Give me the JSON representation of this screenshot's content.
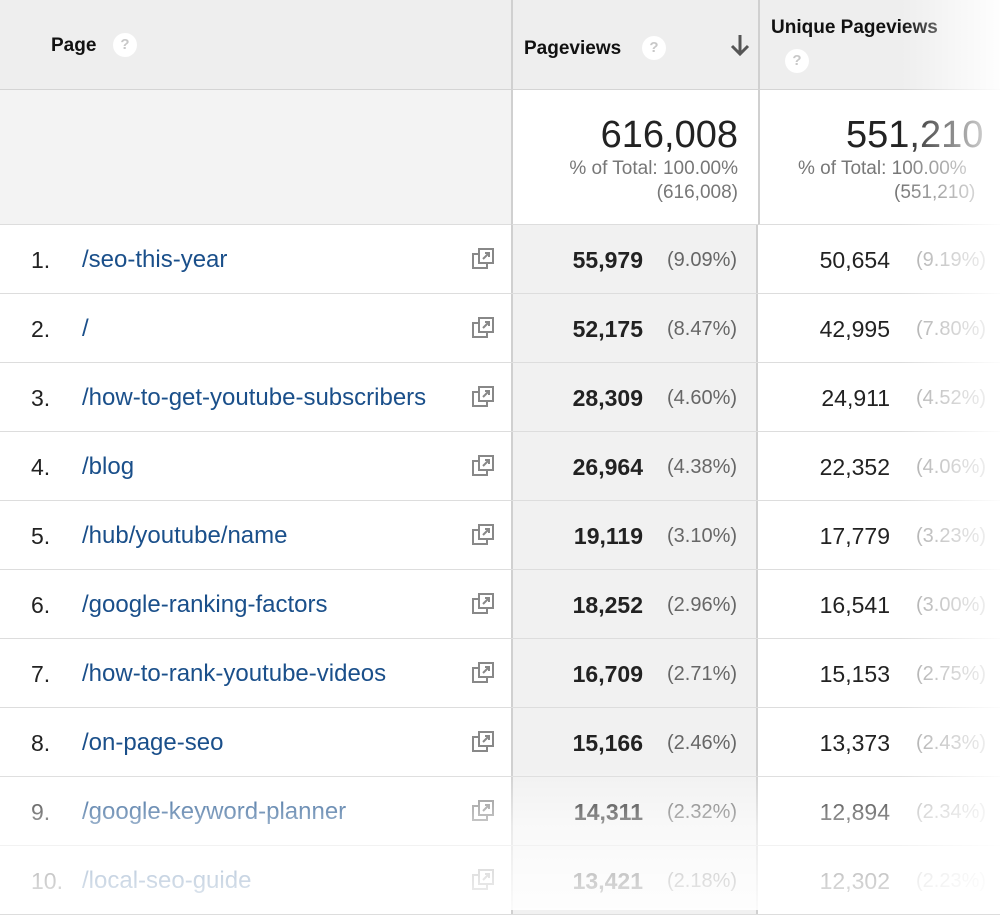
{
  "header": {
    "page_label": "Page",
    "pageviews_label": "Pageviews",
    "unique_pageviews_label": "Unique Pageviews",
    "help_glyph": "?"
  },
  "totals": {
    "pageviews": {
      "value": "616,008",
      "pct_text": "% of Total: 100.00%",
      "paren": "(616,008)"
    },
    "unique_pageviews": {
      "value": "551,210",
      "pct_text": "% of Total: 100.00%",
      "paren": "(551,210)"
    }
  },
  "rows": [
    {
      "idx": "1.",
      "page": "/seo-this-year",
      "pv": "55,979",
      "pv_pct": "(9.09%)",
      "upv": "50,654",
      "upv_pct": "(9.19%)"
    },
    {
      "idx": "2.",
      "page": "/",
      "pv": "52,175",
      "pv_pct": "(8.47%)",
      "upv": "42,995",
      "upv_pct": "(7.80%)"
    },
    {
      "idx": "3.",
      "page": "/how-to-get-youtube-subscribers",
      "pv": "28,309",
      "pv_pct": "(4.60%)",
      "upv": "24,911",
      "upv_pct": "(4.52%)"
    },
    {
      "idx": "4.",
      "page": "/blog",
      "pv": "26,964",
      "pv_pct": "(4.38%)",
      "upv": "22,352",
      "upv_pct": "(4.06%)"
    },
    {
      "idx": "5.",
      "page": "/hub/youtube/name",
      "pv": "19,119",
      "pv_pct": "(3.10%)",
      "upv": "17,779",
      "upv_pct": "(3.23%)"
    },
    {
      "idx": "6.",
      "page": "/google-ranking-factors",
      "pv": "18,252",
      "pv_pct": "(2.96%)",
      "upv": "16,541",
      "upv_pct": "(3.00%)"
    },
    {
      "idx": "7.",
      "page": "/how-to-rank-youtube-videos",
      "pv": "16,709",
      "pv_pct": "(2.71%)",
      "upv": "15,153",
      "upv_pct": "(2.75%)"
    },
    {
      "idx": "8.",
      "page": "/on-page-seo",
      "pv": "15,166",
      "pv_pct": "(2.46%)",
      "upv": "13,373",
      "upv_pct": "(2.43%)"
    },
    {
      "idx": "9.",
      "page": "/google-keyword-planner",
      "pv": "14,311",
      "pv_pct": "(2.32%)",
      "upv": "12,894",
      "upv_pct": "(2.34%)"
    },
    {
      "idx": "10.",
      "page": "/local-seo-guide",
      "pv": "13,421",
      "pv_pct": "(2.18%)",
      "upv": "12,302",
      "upv_pct": "(2.23%)"
    }
  ],
  "icons": {
    "sort": "sort-descending-arrow-icon",
    "open": "open-external-icon",
    "help": "help-icon"
  },
  "colors": {
    "link": "#1a4f8a",
    "header_bg": "#eeeeee",
    "pv_col_bg": "#f1f1f1"
  }
}
